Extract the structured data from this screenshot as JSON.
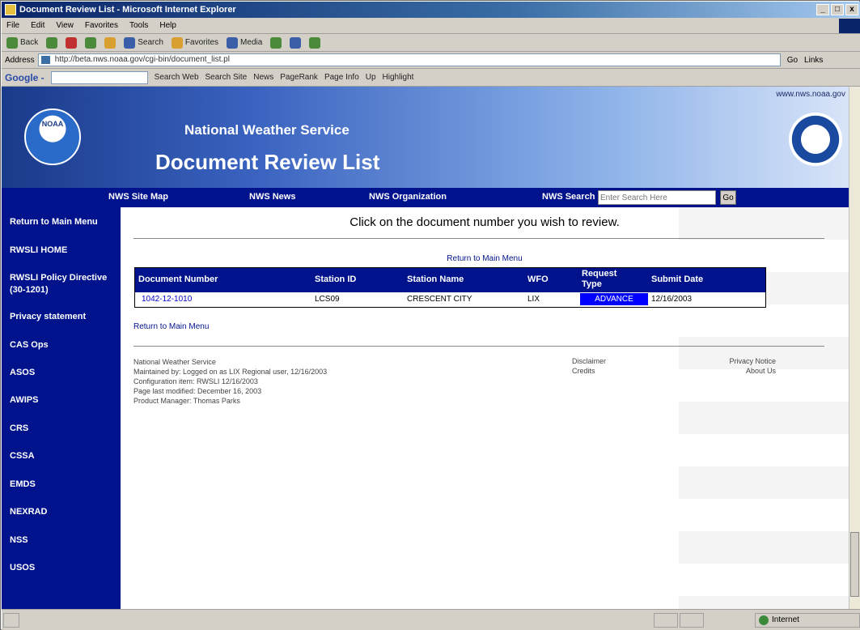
{
  "window": {
    "title": "Document Review List - Microsoft Internet Explorer",
    "buttons": [
      "_",
      "□",
      "x"
    ]
  },
  "menu": [
    "File",
    "Edit",
    "View",
    "Favorites",
    "Tools",
    "Help"
  ],
  "toolbar": {
    "back": "Back",
    "search": "Search",
    "favorites": "Favorites",
    "media": "Media"
  },
  "address": {
    "label": "Address",
    "value": "http://beta.nws.noaa.gov/cgi-bin/document_list.pl",
    "go": "Go",
    "links": "Links"
  },
  "googlebar": {
    "logo": "Google -",
    "search_web": "Search Web",
    "search_site": "Search Site",
    "news": "News",
    "pagerank": "PageRank",
    "page_info": "Page Info",
    "up": "Up",
    "highlight": "Highlight"
  },
  "banner": {
    "site_url": "www.nws.noaa.gov",
    "noaa": "NOAA",
    "org": "National Weather Service",
    "heading": "Document Review List"
  },
  "nav": {
    "site_map": "NWS Site Map",
    "news": "NWS News",
    "organization": "NWS Organization",
    "search": "NWS Search",
    "search_placeholder": "Enter Search Here",
    "go": "Go"
  },
  "sidebar": [
    "Return to Main Menu",
    "RWSLI HOME",
    "RWSLI Policy Directive (30-1201)",
    "Privacy statement",
    "CAS Ops",
    "ASOS",
    "AWIPS",
    "CRS",
    "CSSA",
    "EMDS",
    "NEXRAD",
    "NSS",
    "USOS"
  ],
  "content": {
    "instruction": "Click on the document number you wish to review.",
    "return_top": "Return to Main Menu",
    "return_bottom": "Return to Main Menu"
  },
  "table": {
    "headers": {
      "doc_number": "Document Number",
      "station_id": "Station ID",
      "station_name": "Station Name",
      "wfo": "WFO",
      "request_type": "Request Type",
      "submit_date": "Submit Date"
    },
    "rows": [
      {
        "doc_number": "1042-12-1010",
        "station_id": "LCS09",
        "station_name": "CRESCENT CITY",
        "wfo": "LIX",
        "request_type": "ADVANCE",
        "submit_date": "12/16/2003"
      }
    ]
  },
  "footer": {
    "lines": [
      "National Weather Service",
      "Maintained by: Logged on as LIX Regional user, 12/16/2003",
      "Configuration item: RWSLI 12/16/2003",
      "Page last modified: December 16, 2003",
      "Product Manager: Thomas Parks"
    ],
    "disclaimer": "Disclaimer",
    "credits": "Credits",
    "privacy": "Privacy Notice",
    "about": "About Us"
  },
  "statusbar": {
    "zone": "Internet"
  },
  "colors": {
    "nav_blue": "#00138c",
    "badge_blue": "#0000ff"
  }
}
